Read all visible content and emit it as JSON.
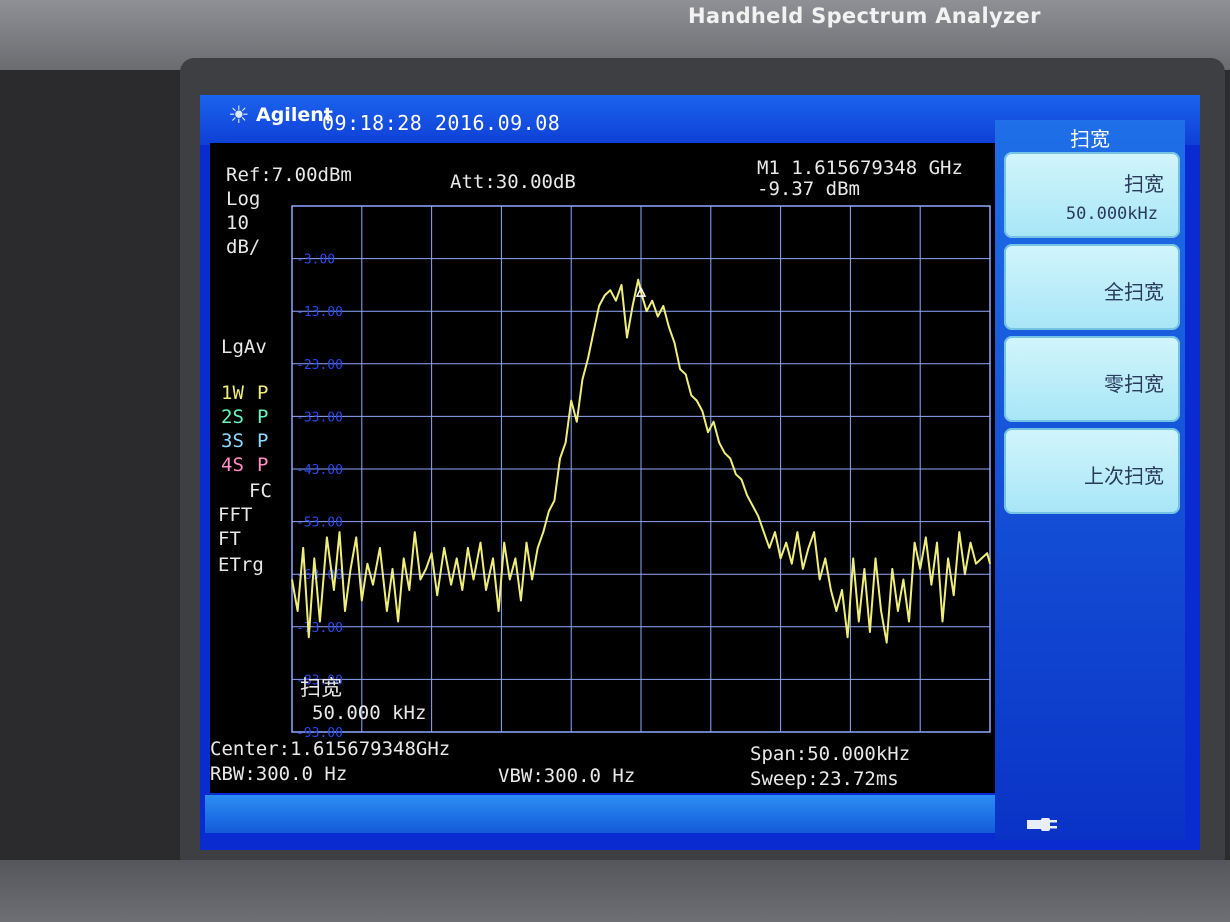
{
  "device": {
    "model_title": "Handheld Spectrum Analyzer"
  },
  "header": {
    "brand": "Agilent",
    "datetime": "09:18:28 2016.09.08",
    "logo_icon": "agilent-spark-icon"
  },
  "measurement": {
    "ref": "Ref:7.00dBm",
    "scale_type": "Log",
    "scale_value": "10",
    "scale_unit": "dB/",
    "attenuation": "Att:30.00dB",
    "marker_freq": "M1 1.615679348 GHz",
    "marker_ampl": "-9.37 dBm",
    "averaging": "LgAv",
    "traces": [
      {
        "label": "1W",
        "mode": "P",
        "color": "#f0ee7a"
      },
      {
        "label": "2S",
        "mode": "P",
        "color": "#67f5c8"
      },
      {
        "label": "3S",
        "mode": "P",
        "color": "#8fd9ff"
      },
      {
        "label": "4S",
        "mode": "P",
        "color": "#ff8ec6"
      }
    ],
    "flags": [
      "FC",
      "FFT",
      "FT",
      "ETrg"
    ],
    "overlay_label": "扫宽",
    "overlay_value": "50.000 kHz",
    "center": "Center:1.615679348GHz",
    "rbw": "RBW:300.0 Hz",
    "vbw": "VBW:300.0 Hz",
    "span": "Span:50.000kHz",
    "sweep": "Sweep:23.72ms"
  },
  "softkeys": {
    "menu_title": "扫宽",
    "items": [
      {
        "label": "扫宽",
        "value": "50.000kHz"
      },
      {
        "label": "全扫宽",
        "value": ""
      },
      {
        "label": "零扫宽",
        "value": ""
      },
      {
        "label": "上次扫宽",
        "value": ""
      }
    ]
  },
  "status": {
    "power_icon": "power-plug-icon"
  },
  "chart_data": {
    "type": "line",
    "y_axis_labels": [
      "-3.00",
      "-13.00",
      "-23.00",
      "-33.00",
      "-43.00",
      "-53.00",
      "-63.00",
      "-73.00",
      "-83.00",
      "-93.00"
    ],
    "ylim": [
      -93,
      7
    ],
    "xlim": [
      -25,
      25
    ],
    "x_unit": "kHz offset from center",
    "y_unit": "dBm",
    "grid": true,
    "trace_color": "#f0ee7a",
    "marker_x": 0.0,
    "marker_y": -9.37,
    "trace_points": [
      [
        -25.0,
        -64
      ],
      [
        -24.6,
        -70
      ],
      [
        -24.2,
        -58
      ],
      [
        -23.8,
        -75
      ],
      [
        -23.4,
        -60
      ],
      [
        -23.0,
        -72
      ],
      [
        -22.5,
        -56
      ],
      [
        -22.0,
        -66
      ],
      [
        -21.6,
        -55
      ],
      [
        -21.2,
        -70
      ],
      [
        -20.8,
        -62
      ],
      [
        -20.4,
        -56
      ],
      [
        -20.0,
        -68
      ],
      [
        -19.6,
        -61
      ],
      [
        -19.2,
        -65
      ],
      [
        -18.7,
        -58
      ],
      [
        -18.2,
        -70
      ],
      [
        -17.8,
        -62
      ],
      [
        -17.4,
        -72
      ],
      [
        -17.0,
        -60
      ],
      [
        -16.6,
        -66
      ],
      [
        -16.2,
        -55
      ],
      [
        -15.8,
        -64
      ],
      [
        -15.4,
        -62
      ],
      [
        -15.0,
        -59
      ],
      [
        -14.6,
        -67
      ],
      [
        -14.1,
        -58
      ],
      [
        -13.6,
        -65
      ],
      [
        -13.2,
        -60
      ],
      [
        -12.8,
        -66
      ],
      [
        -12.4,
        -58
      ],
      [
        -12.0,
        -64
      ],
      [
        -11.5,
        -57
      ],
      [
        -11.1,
        -66
      ],
      [
        -10.6,
        -60
      ],
      [
        -10.2,
        -70
      ],
      [
        -9.8,
        -57
      ],
      [
        -9.4,
        -64
      ],
      [
        -9.0,
        -60
      ],
      [
        -8.6,
        -68
      ],
      [
        -8.2,
        -57
      ],
      [
        -7.8,
        -64
      ],
      [
        -7.4,
        -58
      ],
      [
        -7.0,
        -55
      ],
      [
        -6.6,
        -51
      ],
      [
        -6.2,
        -49
      ],
      [
        -5.8,
        -41
      ],
      [
        -5.4,
        -38
      ],
      [
        -5.0,
        -30
      ],
      [
        -4.6,
        -34
      ],
      [
        -4.2,
        -26
      ],
      [
        -3.8,
        -22
      ],
      [
        -3.4,
        -17
      ],
      [
        -3.0,
        -12
      ],
      [
        -2.6,
        -10
      ],
      [
        -2.2,
        -9
      ],
      [
        -1.8,
        -11
      ],
      [
        -1.4,
        -8
      ],
      [
        -1.0,
        -18
      ],
      [
        -0.6,
        -12
      ],
      [
        -0.2,
        -7
      ],
      [
        0.0,
        -9.37
      ],
      [
        0.4,
        -13
      ],
      [
        0.8,
        -11
      ],
      [
        1.2,
        -14
      ],
      [
        1.6,
        -12
      ],
      [
        2.0,
        -16
      ],
      [
        2.4,
        -19
      ],
      [
        2.8,
        -24
      ],
      [
        3.2,
        -25
      ],
      [
        3.6,
        -29
      ],
      [
        4.0,
        -30
      ],
      [
        4.4,
        -32
      ],
      [
        4.8,
        -36
      ],
      [
        5.2,
        -34
      ],
      [
        5.6,
        -38
      ],
      [
        6.0,
        -40
      ],
      [
        6.4,
        -41
      ],
      [
        6.8,
        -44
      ],
      [
        7.2,
        -45
      ],
      [
        7.6,
        -48
      ],
      [
        8.0,
        -50
      ],
      [
        8.4,
        -52
      ],
      [
        8.8,
        -55
      ],
      [
        9.2,
        -58
      ],
      [
        9.6,
        -55
      ],
      [
        10.0,
        -60
      ],
      [
        10.4,
        -57
      ],
      [
        10.8,
        -61
      ],
      [
        11.2,
        -55
      ],
      [
        11.6,
        -62
      ],
      [
        12.0,
        -58
      ],
      [
        12.4,
        -55
      ],
      [
        12.8,
        -64
      ],
      [
        13.2,
        -60
      ],
      [
        13.6,
        -66
      ],
      [
        14.0,
        -70
      ],
      [
        14.4,
        -66
      ],
      [
        14.8,
        -75
      ],
      [
        15.2,
        -60
      ],
      [
        15.6,
        -72
      ],
      [
        16.0,
        -62
      ],
      [
        16.4,
        -74
      ],
      [
        16.8,
        -60
      ],
      [
        17.2,
        -70
      ],
      [
        17.6,
        -76
      ],
      [
        18.0,
        -62
      ],
      [
        18.4,
        -70
      ],
      [
        18.8,
        -64
      ],
      [
        19.2,
        -72
      ],
      [
        19.6,
        -57
      ],
      [
        20.0,
        -62
      ],
      [
        20.4,
        -56
      ],
      [
        20.8,
        -65
      ],
      [
        21.2,
        -57
      ],
      [
        21.6,
        -72
      ],
      [
        22.0,
        -60
      ],
      [
        22.4,
        -67
      ],
      [
        22.8,
        -55
      ],
      [
        23.2,
        -63
      ],
      [
        23.6,
        -57
      ],
      [
        24.0,
        -61
      ],
      [
        24.4,
        -60
      ],
      [
        24.8,
        -59
      ],
      [
        25.0,
        -61
      ]
    ]
  }
}
